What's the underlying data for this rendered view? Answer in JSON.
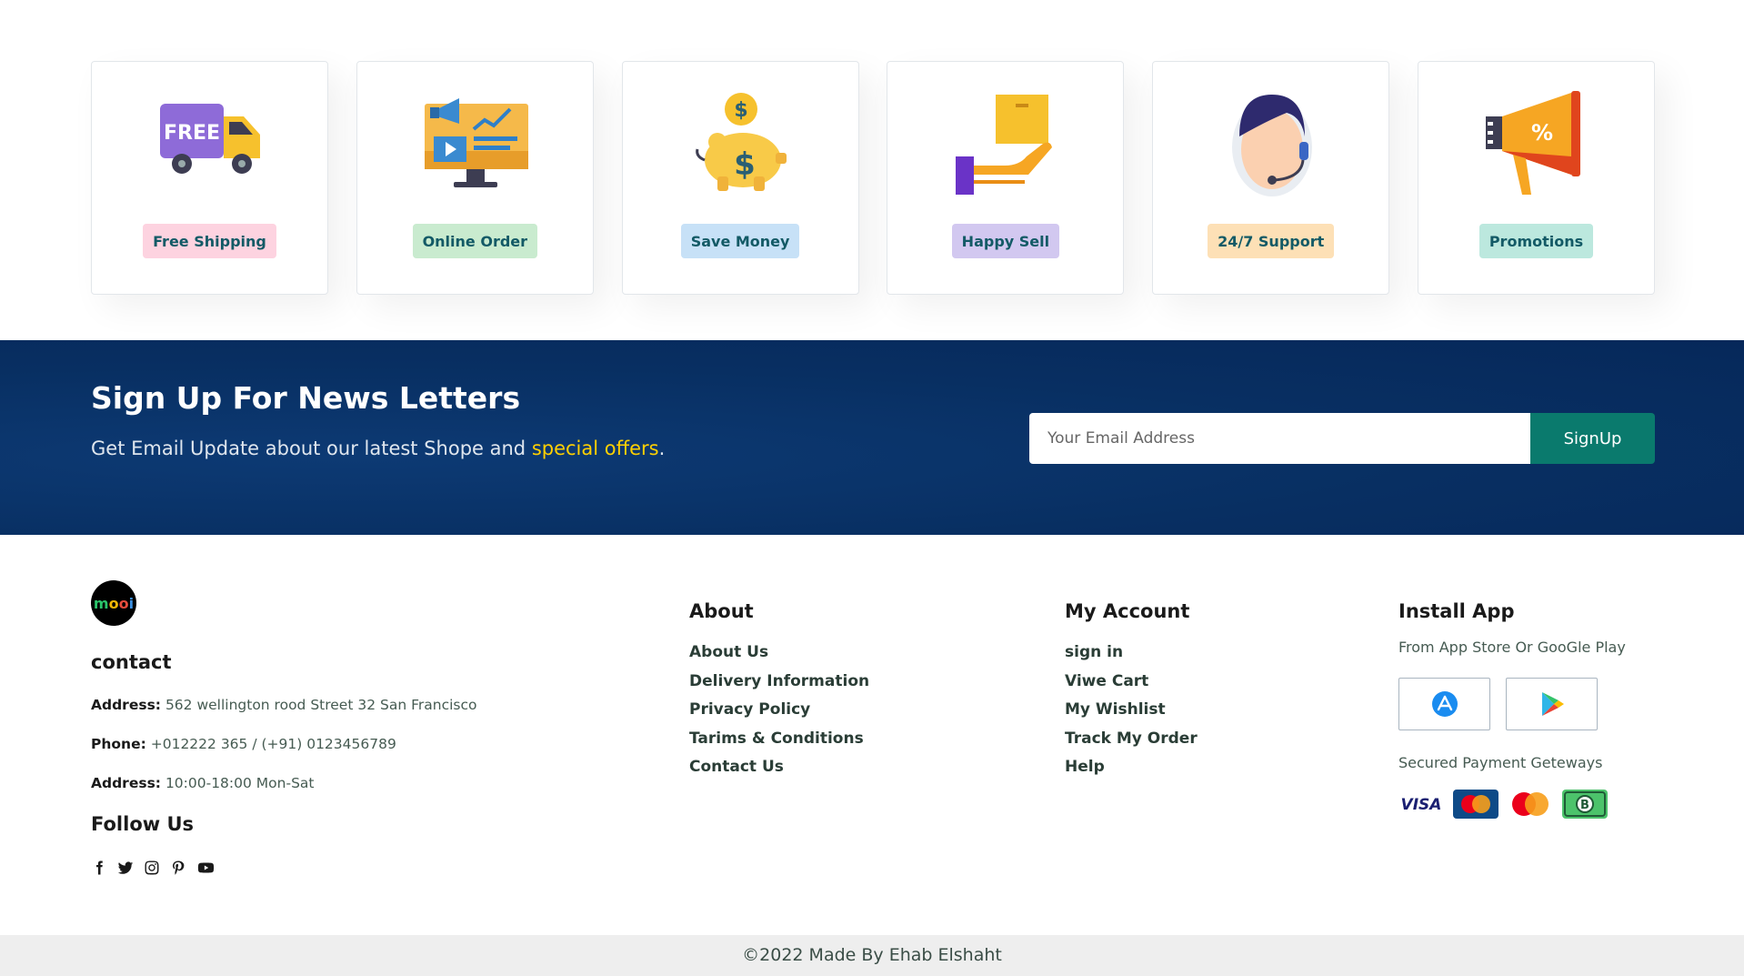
{
  "features": [
    {
      "label": "Free Shipping",
      "icon": "free-shipping-truck-icon",
      "badge_color": "#fdd3e0",
      "truck_text": "FREE"
    },
    {
      "label": "Online Order",
      "icon": "online-order-monitor-icon",
      "badge_color": "#c9ebcf"
    },
    {
      "label": "Save Money",
      "icon": "piggy-bank-icon",
      "badge_color": "#c7e1f7"
    },
    {
      "label": "Happy Sell",
      "icon": "hand-package-icon",
      "badge_color": "#d2c8f0"
    },
    {
      "label": "24/7 Support",
      "icon": "support-agent-icon",
      "badge_color": "#fde0b6"
    },
    {
      "label": "Promotions",
      "icon": "megaphone-icon",
      "badge_color": "#bce8de"
    }
  ],
  "newsletter": {
    "title": "Sign Up For News Letters",
    "subtitle_prefix": "Get Email Update about our latest Shope and ",
    "subtitle_highlight": "special offers",
    "subtitle_suffix": ".",
    "email_placeholder": "Your Email Address",
    "button_label": "SignUp",
    "colors": {
      "background": "#082f62",
      "button": "#0a7a6d",
      "highlight": "#ffd000"
    }
  },
  "footer": {
    "logo_letters": [
      "m",
      "o",
      "o",
      "i"
    ],
    "contact": {
      "heading": "contact",
      "address_label": "Address:",
      "address_value": "562 wellington rood Street 32 San Francisco",
      "phone_label": "Phone:",
      "phone_value": "+012222 365 / (+91) 0123456789",
      "hours_label": "Address:",
      "hours_value": "10:00-18:00 Mon-Sat"
    },
    "follow": {
      "heading": "Follow Us",
      "icons": [
        "facebook-icon",
        "twitter-icon",
        "instagram-icon",
        "pinterest-icon",
        "youtube-icon"
      ]
    },
    "about": {
      "heading": "About",
      "links": [
        "About Us",
        "Delivery Information",
        "Privacy Policy",
        "Tarims & Conditions",
        "Contact Us"
      ]
    },
    "account": {
      "heading": "My Account",
      "links": [
        "sign in",
        "Viwe Cart",
        "My Wishlist",
        "Track My Order",
        "Help"
      ]
    },
    "install": {
      "heading": "Install App",
      "subtitle": "From App Store Or GooGle Play",
      "stores": [
        "app-store-icon",
        "google-play-icon"
      ],
      "payment_label": "Secured Payment Geteways",
      "payments": [
        "visa-icon",
        "mastercard-icon",
        "mastercard-alt-icon",
        "bitcoin-icon"
      ]
    }
  },
  "copyright": "©2022 Made By Ehab Elshaht"
}
